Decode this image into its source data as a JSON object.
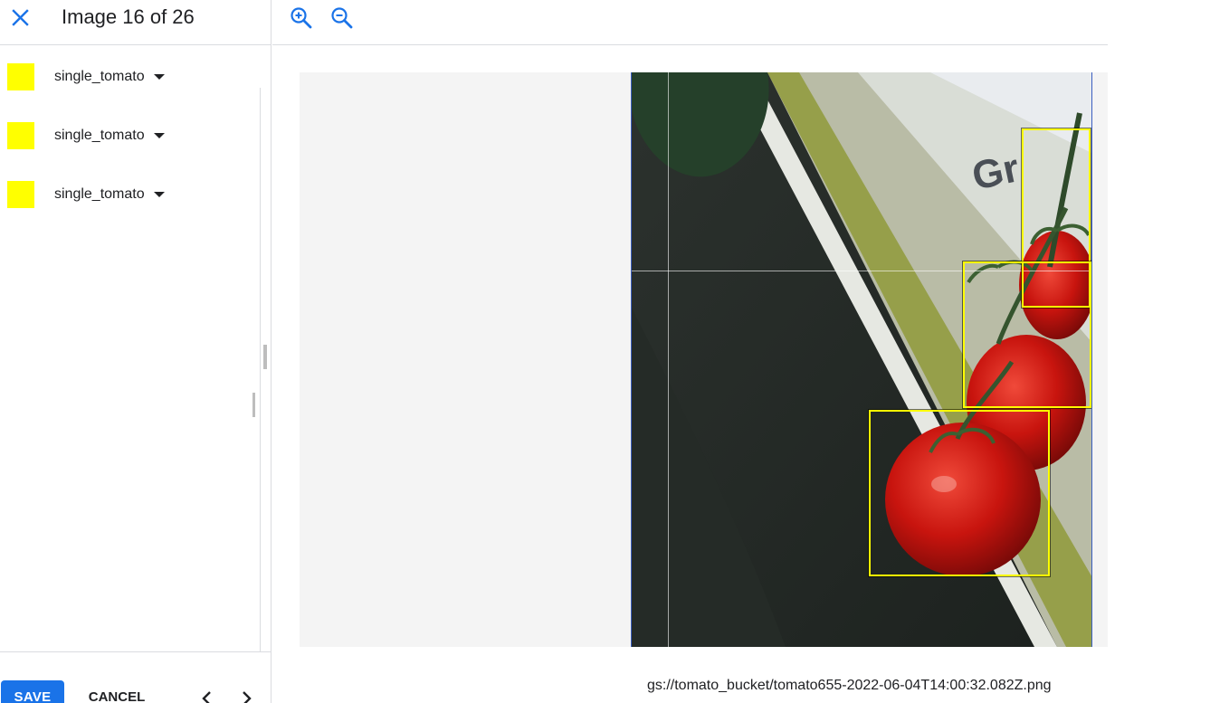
{
  "header": {
    "title": "Image 16 of 26",
    "close_icon": "close-icon"
  },
  "labels": [
    {
      "name": "single_tomato",
      "color": "#ffff00"
    },
    {
      "name": "single_tomato",
      "color": "#ffff00"
    },
    {
      "name": "single_tomato",
      "color": "#ffff00"
    }
  ],
  "footer": {
    "save_label": "SAVE",
    "cancel_label": "CANCEL",
    "prev_icon": "chevron-left-icon",
    "next_icon": "chevron-right-icon"
  },
  "toolbar": {
    "zoom_in_icon": "zoom-in-icon",
    "zoom_out_icon": "zoom-out-icon"
  },
  "image": {
    "path": "gs://tomato_bucket/tomato655-2022-06-04T14:00:32.082Z.png",
    "annotation_color": "#ffff00"
  },
  "colors": {
    "accent": "#1a73e8",
    "bbox": "#ffff00"
  }
}
